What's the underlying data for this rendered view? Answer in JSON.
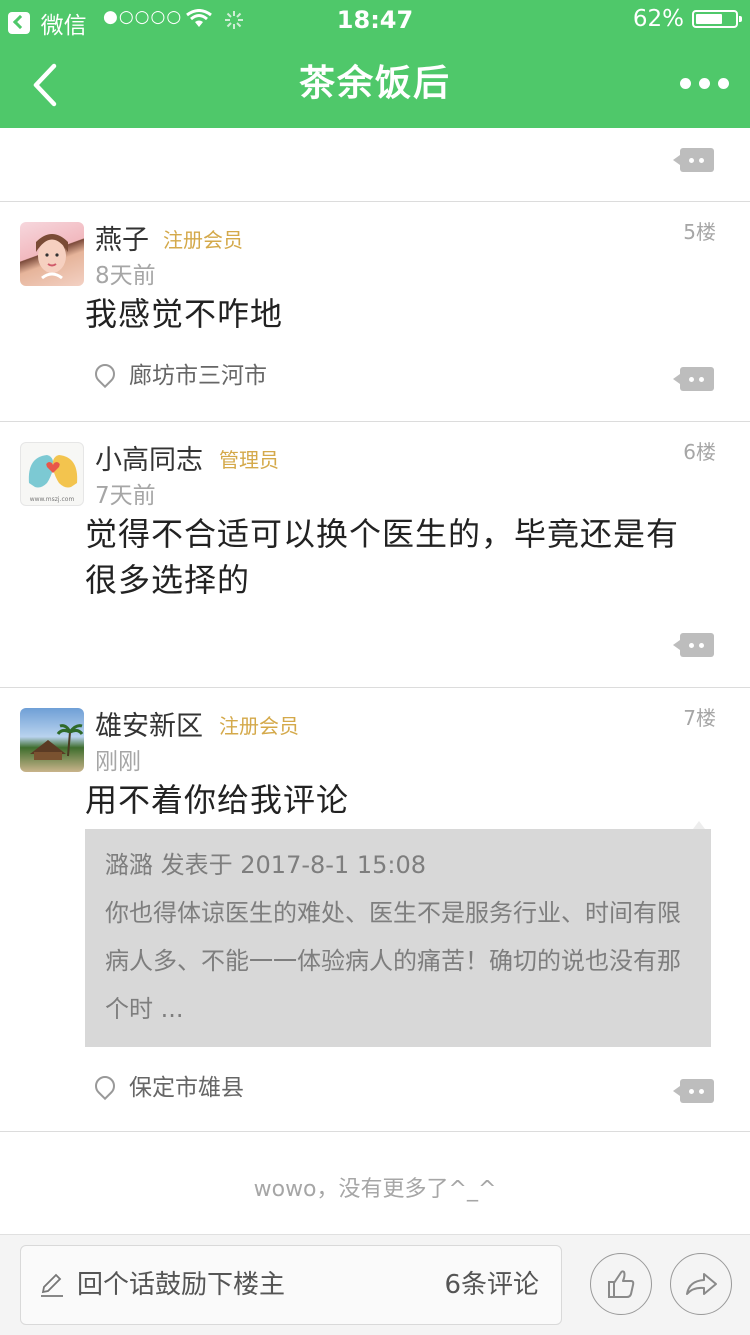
{
  "status_bar": {
    "back_app": "微信",
    "signal": "●○○○○",
    "time": "18:47",
    "battery_percent": "62%"
  },
  "nav": {
    "title": "茶余饭后"
  },
  "posts": [
    {
      "username": "燕子",
      "role": "注册会员",
      "time": "8天前",
      "floor": "5楼",
      "content": "我感觉不咋地",
      "location": "廊坊市三河市"
    },
    {
      "username": "小高同志",
      "role": "管理员",
      "time": "7天前",
      "floor": "6楼",
      "content": "觉得不合适可以换个医生的，毕竟还是有很多选择的",
      "avatar_caption": "www.mszj.com"
    },
    {
      "username": "雄安新区",
      "role": "注册会员",
      "time": "刚刚",
      "floor": "7楼",
      "content": "用不着你给我评论",
      "quote": {
        "header": "潞潞 发表于 2017-8-1 15:08",
        "text": "你也得体谅医生的难处、医生不是服务行业、时间有限病人多、不能一一体验病人的痛苦！确切的说也没有那个时 ..."
      },
      "location": "保定市雄县"
    }
  ],
  "no_more": "wowo，没有更多了^_^",
  "bottom_bar": {
    "reply_placeholder": "回个话鼓励下楼主",
    "comment_count": "6条评论"
  },
  "colors": {
    "brand_green": "#4fc86a",
    "role_gold": "#d4a94a"
  }
}
